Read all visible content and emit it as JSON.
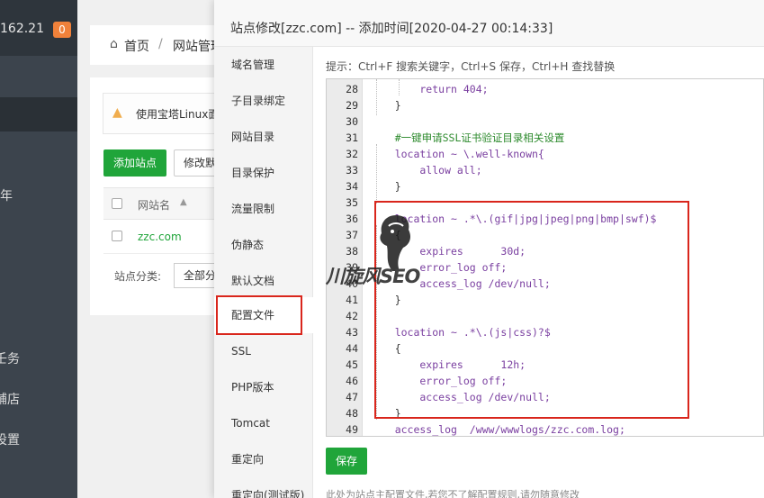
{
  "sidebar": {
    "server_ip": "162.21",
    "notify_count": "0",
    "fragments": [
      "年",
      "壬务",
      "铺店",
      "设置"
    ]
  },
  "breadcrumb": {
    "home": "首页",
    "sep": "/",
    "current": "网站管理"
  },
  "content": {
    "warning": "使用宝塔Linux面板创建站点时会自动",
    "add_site": "添加站点",
    "modify": "修改默认页",
    "col_name": "网站名",
    "site": "zzc.com",
    "category_label": "站点分类:",
    "category_value": "全部分类"
  },
  "modal": {
    "title": "站点修改[zzc.com] -- 添加时间[2020-04-27 00:14:33]",
    "nav": [
      "域名管理",
      "子目录绑定",
      "网站目录",
      "目录保护",
      "流量限制",
      "伪静态",
      "默认文档",
      "配置文件",
      "SSL",
      "PHP版本",
      "Tomcat",
      "重定向",
      "重定向(测试版)"
    ],
    "active_nav_index": 7,
    "tips": "提示：Ctrl+F 搜索关键字，Ctrl+S 保存，Ctrl+H 查找替换",
    "save_label": "保存",
    "footer_note": "此处为站点主配置文件,若您不了解配置规则,请勿随意修改"
  },
  "code_lines": [
    {
      "n": "28",
      "t": "        return 404;"
    },
    {
      "n": "29",
      "t": "    }"
    },
    {
      "n": "30",
      "t": ""
    },
    {
      "n": "31",
      "t": "    #一键申请SSL证书验证目录相关设置"
    },
    {
      "n": "32",
      "t": "    location ~ \\.well-known{"
    },
    {
      "n": "33",
      "t": "        allow all;"
    },
    {
      "n": "34",
      "t": "    }"
    },
    {
      "n": "35",
      "t": ""
    },
    {
      "n": "36",
      "t": "    location ~ .*\\.(gif|jpg|jpeg|png|bmp|swf)$"
    },
    {
      "n": "37",
      "t": "    {"
    },
    {
      "n": "38",
      "t": "        expires      30d;"
    },
    {
      "n": "39",
      "t": "        error_log off;"
    },
    {
      "n": "40",
      "t": "        access_log /dev/null;"
    },
    {
      "n": "41",
      "t": "    }"
    },
    {
      "n": "42",
      "t": ""
    },
    {
      "n": "43",
      "t": "    location ~ .*\\.(js|css)?$"
    },
    {
      "n": "44",
      "t": "    {"
    },
    {
      "n": "45",
      "t": "        expires      12h;"
    },
    {
      "n": "46",
      "t": "        error_log off;"
    },
    {
      "n": "47",
      "t": "        access_log /dev/null;"
    },
    {
      "n": "48",
      "t": "    }"
    },
    {
      "n": "49",
      "t": "    access_log  /www/wwwlogs/zzc.com.log;"
    }
  ],
  "watermark": "川旋风SEO",
  "colors": {
    "accent": "#20a53a",
    "highlight": "#d9261c",
    "badge": "#f0813a"
  }
}
